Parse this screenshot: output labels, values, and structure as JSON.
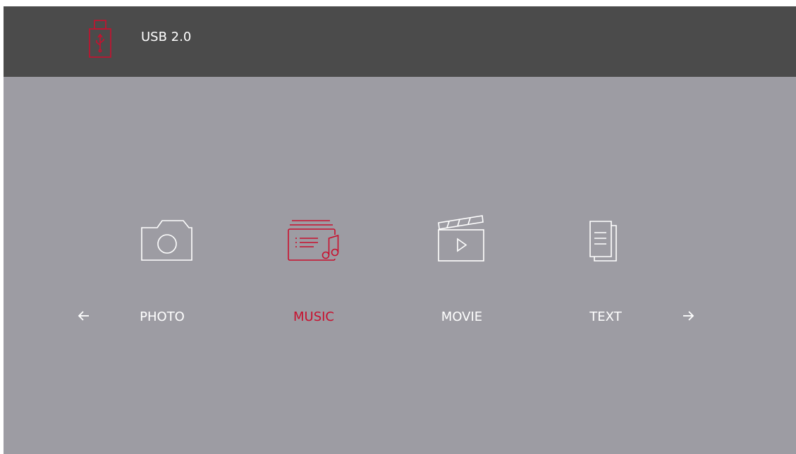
{
  "header": {
    "source_label": "USB 2.0",
    "source_icon": "usb-drive-icon"
  },
  "media_types": [
    {
      "label": "PHOTO",
      "icon": "camera-icon",
      "selected": false
    },
    {
      "label": "MUSIC",
      "icon": "music-folder-icon",
      "selected": true
    },
    {
      "label": "MOVIE",
      "icon": "clapperboard-icon",
      "selected": false
    },
    {
      "label": "TEXT",
      "icon": "document-icon",
      "selected": false
    }
  ],
  "navigation": {
    "prev_icon": "arrow-left-icon",
    "next_icon": "arrow-right-icon"
  },
  "colors": {
    "accent": "#c8102e",
    "header_bg": "#4b4b4b",
    "body_bg": "#9d9ca3",
    "text": "#ffffff"
  }
}
